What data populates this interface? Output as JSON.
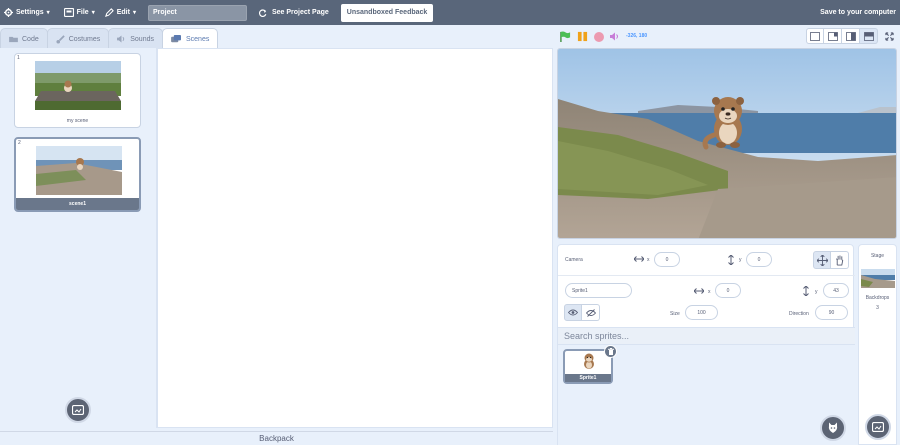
{
  "menubar": {
    "settings_label": "Settings",
    "file_label": "File",
    "edit_label": "Edit",
    "project_title": "Project",
    "see_project_label": "See Project Page",
    "feedback_label": "Unsandboxed Feedback",
    "save_label": "Save to your computer"
  },
  "tabs": [
    {
      "label": "Code",
      "icon": "code-icon"
    },
    {
      "label": "Costumes",
      "icon": "brush-icon"
    },
    {
      "label": "Sounds",
      "icon": "speaker-icon"
    },
    {
      "label": "Scenes",
      "icon": "scenes-icon",
      "active": true
    }
  ],
  "scenes": [
    {
      "number": "1",
      "name": "my scene",
      "selected": false
    },
    {
      "number": "2",
      "name": "scene1",
      "selected": true
    }
  ],
  "backpack_label": "Backpack",
  "stage_header": {
    "mouse_coords": "-326, 180",
    "accent": "#4c97ff"
  },
  "camera": {
    "label": "Camera",
    "x_label": "x",
    "x_value": "0",
    "y_label": "y",
    "y_value": "0"
  },
  "sprite_info": {
    "name": "Sprite1",
    "x_label": "x",
    "x_value": "0",
    "y_label": "y",
    "y_value": "43",
    "size_label": "Size",
    "size_value": "100",
    "direction_label": "Direction",
    "direction_value": "90"
  },
  "search": {
    "placeholder": "Search sprites..."
  },
  "sprites": [
    {
      "name": "Sprite1",
      "selected": true
    }
  ],
  "stage_selector": {
    "title": "Stage",
    "backdrops_label": "Backdrops",
    "backdrops_count": "3"
  },
  "colors": {
    "menubar": "#59667a",
    "background": "#e8f0fb",
    "selected": "#6a778b"
  }
}
